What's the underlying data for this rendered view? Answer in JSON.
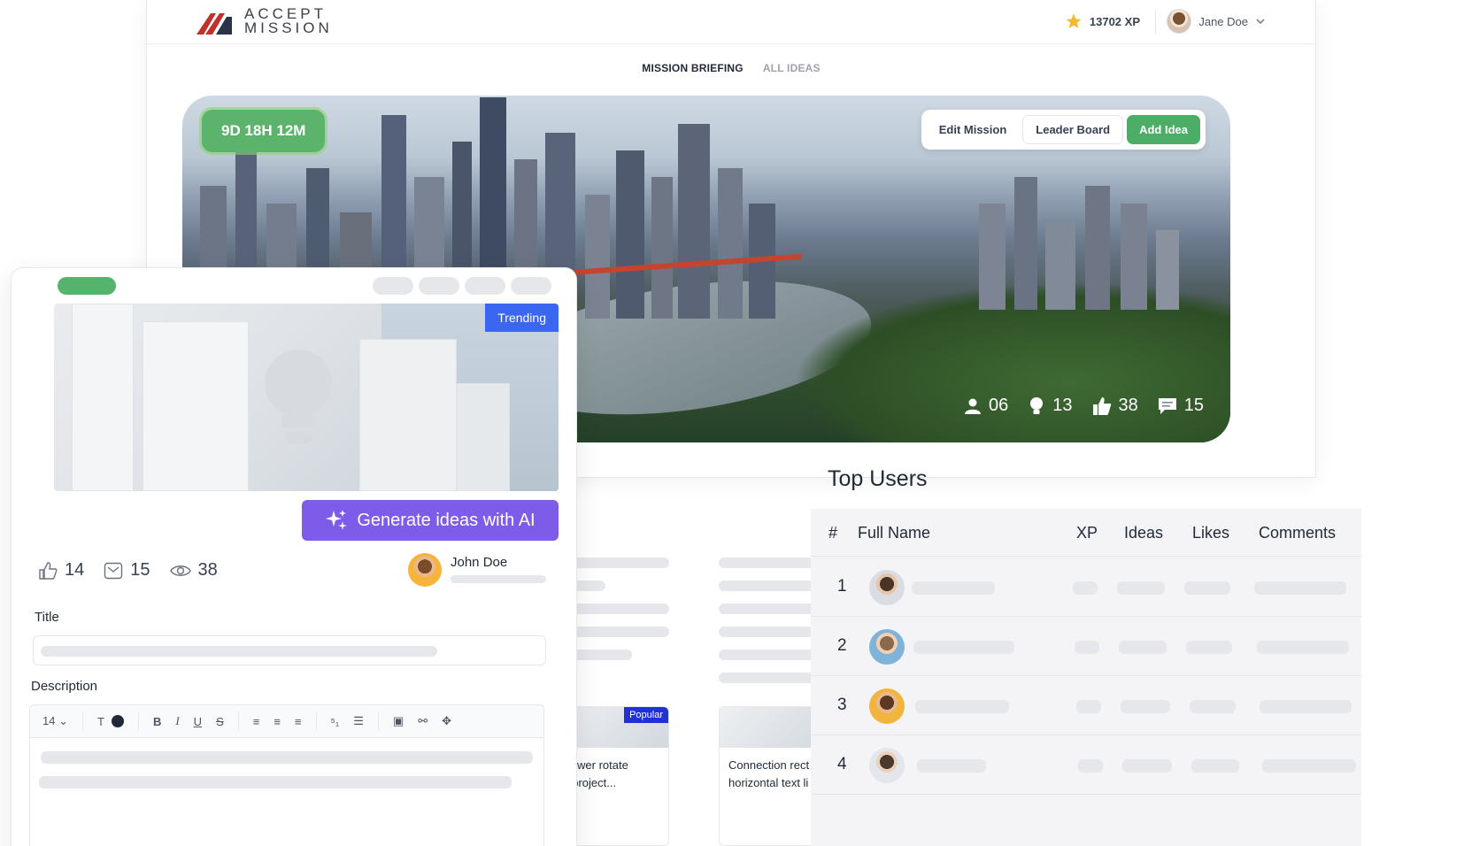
{
  "header": {
    "logo_line1": "ACCEPT",
    "logo_line2": "MISSION",
    "xp": "13702 XP",
    "user_name": "Jane Doe"
  },
  "tabs": [
    {
      "label": "MISSION BRIEFING",
      "active": true
    },
    {
      "label": "ALL IDEAS",
      "active": false
    }
  ],
  "hero": {
    "timer": "9D 18H 12M",
    "actions": {
      "edit": "Edit Mission",
      "leaderboard": "Leader Board",
      "add": "Add Idea"
    },
    "stats": {
      "participants": "06",
      "ideas": "13",
      "likes": "38",
      "comments": "15"
    }
  },
  "idea_card": {
    "badge": "Trending",
    "ai_button": "Generate ideas with AI",
    "likes": "14",
    "comments": "15",
    "views": "38",
    "author": "John Doe",
    "title_label": "Title",
    "description_label": "Description",
    "font_size": "14"
  },
  "ideas": [
    {
      "badge": "Popular",
      "line1": "llower rotate",
      "line2": "t project..."
    },
    {
      "badge": "",
      "line1": "Connection rect",
      "line2": "horizontal text li"
    }
  ],
  "top_users": {
    "title": "Top Users",
    "columns": [
      "#",
      "Full Name",
      "XP",
      "Ideas",
      "Likes",
      "Comments"
    ],
    "rows": [
      "1",
      "2",
      "3",
      "4"
    ]
  },
  "colors": {
    "primary_green": "#4cae66",
    "ai_purple": "#7c5ce8",
    "trending_blue": "#3b66f0",
    "popular_blue": "#2131d8"
  }
}
